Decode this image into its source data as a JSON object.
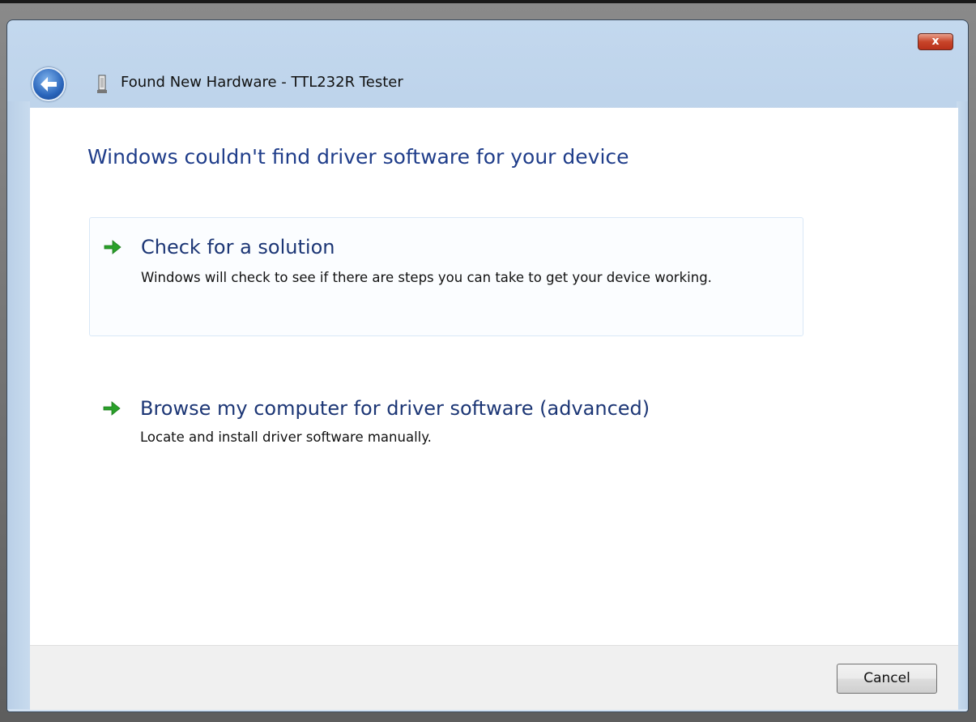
{
  "window": {
    "title": "Found New Hardware - TTL232R Tester",
    "close_label": "x"
  },
  "icons": {
    "back": "back-arrow-icon",
    "hardware": "usb-device-icon",
    "option_arrow": "green-arrow-icon",
    "close": "close-icon"
  },
  "main": {
    "heading": "Windows couldn't find driver software for your device",
    "options": [
      {
        "title": "Check for a solution",
        "description": "Windows will check to see if there are steps you can take to get your device working."
      },
      {
        "title": "Browse my computer for driver software (advanced)",
        "description": "Locate and install driver software manually."
      }
    ]
  },
  "footer": {
    "cancel_label": "Cancel"
  },
  "colors": {
    "heading": "#1f3d8a",
    "arrow_green": "#2aa12a",
    "close_red": "#c8452a"
  }
}
